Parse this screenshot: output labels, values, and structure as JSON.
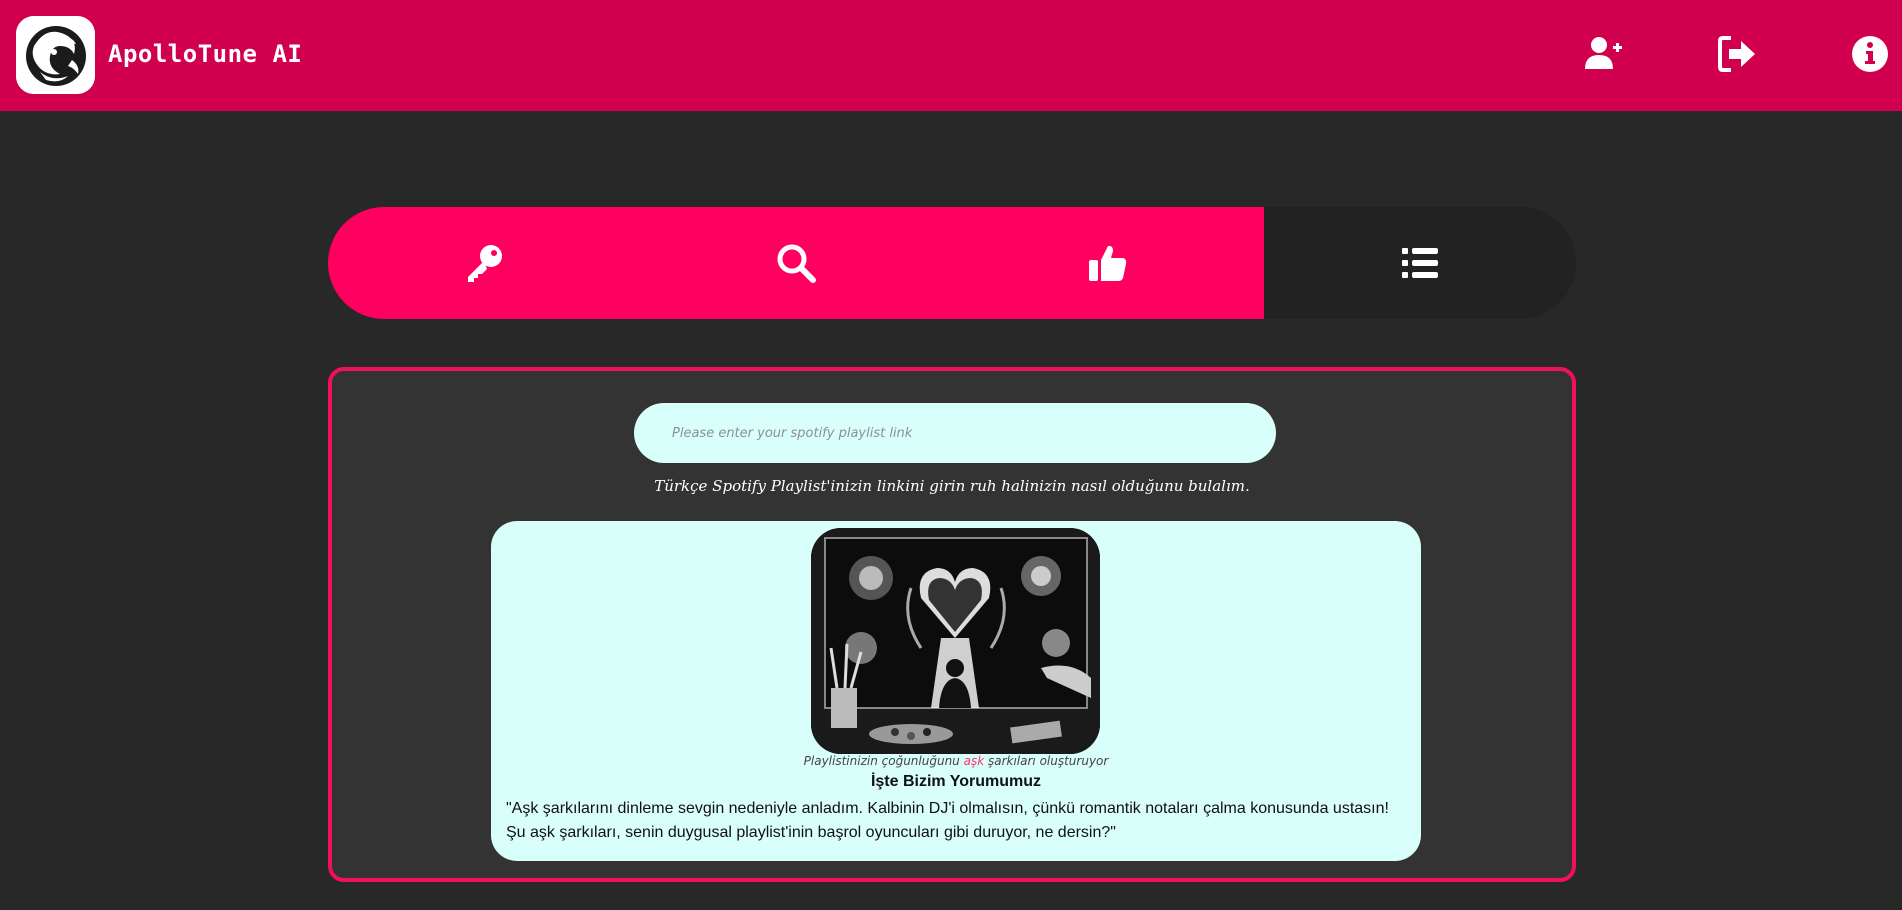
{
  "header": {
    "app_title": "ApolloTune AI",
    "background_color": "#d1004e",
    "icons": [
      "add-user-icon",
      "sign-out-icon",
      "info-icon"
    ]
  },
  "tabs": [
    {
      "icon": "key-icon",
      "highlighted": true
    },
    {
      "icon": "search-icon",
      "highlighted": true
    },
    {
      "icon": "thumbs-up-icon",
      "highlighted": true
    },
    {
      "icon": "list-icon",
      "highlighted": false
    }
  ],
  "colors": {
    "accent": "#ff0060",
    "panel_border": "#f0105c",
    "page_background": "#282828",
    "input_background": "#d9fffb"
  },
  "search": {
    "value": "",
    "placeholder": "Please enter your spotify playlist link"
  },
  "hint_text": "Türkçe Spotify Playlist'inizin linkini girin ruh halinizin nasıl olduğunu bulalım.",
  "result": {
    "caption_before": "Playlistinizin çoğunluğunu ",
    "caption_highlight": "aşk",
    "caption_after": " şarkıları oluşturuyor",
    "title": "İşte Bizim Yorumumuz",
    "comment": "\"Aşk şarkılarını dinleme sevgin nedeniyle anladım. Kalbinin DJ'i olmalısın, çünkü romantik notaları çalma konusunda ustasın! Şu aşk şarkıları, senin duygusal playlist'inin başrol oyuncuları gibi duruyor, ne dersin?\""
  }
}
